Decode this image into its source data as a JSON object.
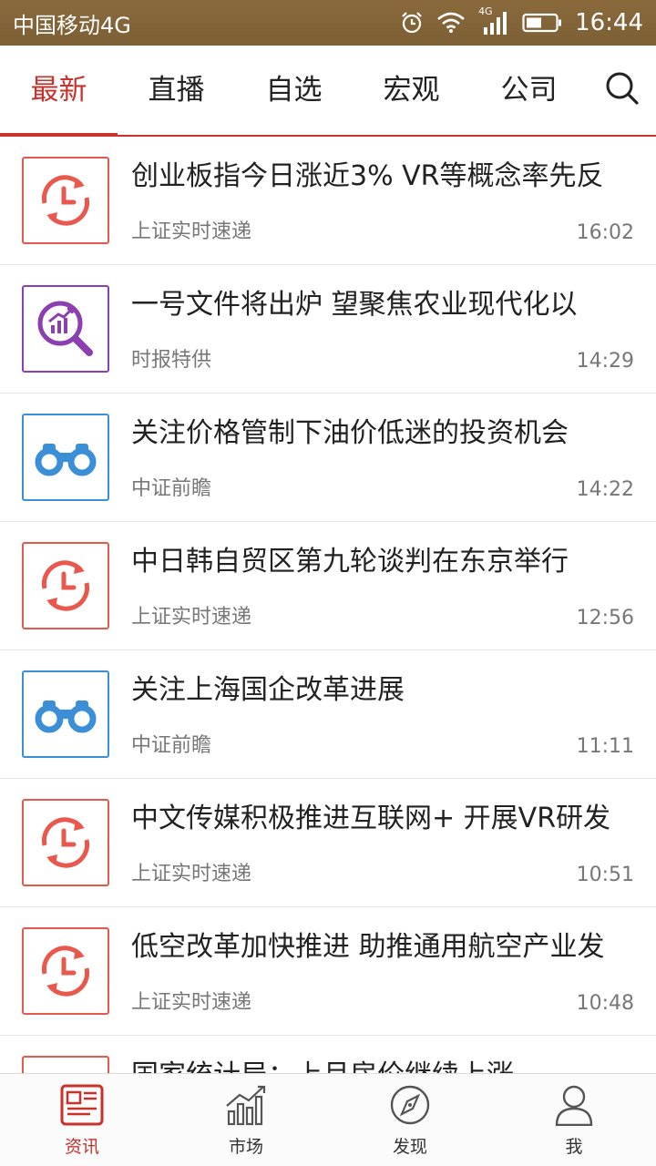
{
  "status_bar": {
    "carrier": "中国移动4G",
    "network_badge": "4G",
    "time": "16:44",
    "icons": [
      "alarm-icon",
      "wifi-icon",
      "signal-icon",
      "battery-icon"
    ]
  },
  "tabs": [
    {
      "label": "最新",
      "active": true
    },
    {
      "label": "直播",
      "active": false
    },
    {
      "label": "自选",
      "active": false
    },
    {
      "label": "宏观",
      "active": false
    },
    {
      "label": "公司",
      "active": false
    }
  ],
  "news": [
    {
      "title": "创业板指今日涨近3%  VR等概念率先反",
      "source": "上证实时速递",
      "time": "16:02",
      "icon": "clock-refresh-icon"
    },
    {
      "title": "一号文件将出炉    望聚焦农业现代化以",
      "source": "时报特供",
      "time": "14:29",
      "icon": "chart-magnifier-icon"
    },
    {
      "title": "关注价格管制下油价低迷的投资机会",
      "source": "中证前瞻",
      "time": "14:22",
      "icon": "binoculars-icon"
    },
    {
      "title": "中日韩自贸区第九轮谈判在东京举行",
      "source": "上证实时速递",
      "time": "12:56",
      "icon": "clock-refresh-icon"
    },
    {
      "title": "关注上海国企改革进展",
      "source": "中证前瞻",
      "time": "11:11",
      "icon": "binoculars-icon"
    },
    {
      "title": "中文传媒积极推进互联网+ 开展VR研发",
      "source": "上证实时速递",
      "time": "10:51",
      "icon": "clock-refresh-icon"
    },
    {
      "title": "低空改革加快推进 助推通用航空产业发",
      "source": "上证实时速递",
      "time": "10:48",
      "icon": "clock-refresh-icon"
    },
    {
      "title": "国家统计局：上月房价继续上涨",
      "source": "",
      "time": "",
      "icon": "clock-refresh-icon"
    }
  ],
  "bottom_nav": [
    {
      "label": "资讯",
      "icon": "news-icon",
      "active": true
    },
    {
      "label": "市场",
      "icon": "market-chart-icon",
      "active": false
    },
    {
      "label": "发现",
      "icon": "compass-icon",
      "active": false
    },
    {
      "label": "我",
      "icon": "person-icon",
      "active": false
    }
  ],
  "colors": {
    "accent": "#c8322a",
    "status_bar": "#7d5f35"
  }
}
